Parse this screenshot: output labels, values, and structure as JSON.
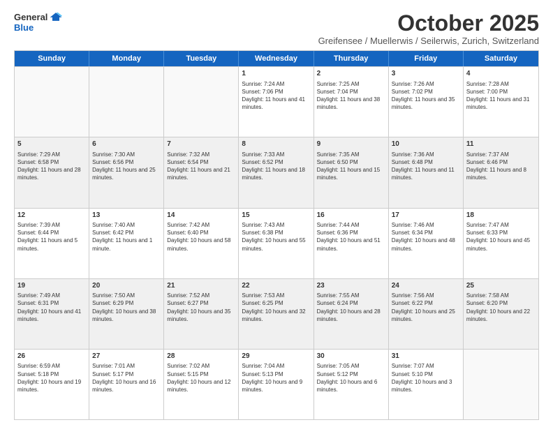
{
  "header": {
    "logo": {
      "general": "General",
      "blue": "Blue"
    },
    "title": "October 2025",
    "subtitle": "Greifensee / Muellerwis / Seilerwis, Zurich, Switzerland"
  },
  "days_of_week": [
    "Sunday",
    "Monday",
    "Tuesday",
    "Wednesday",
    "Thursday",
    "Friday",
    "Saturday"
  ],
  "weeks": [
    [
      {
        "day": "",
        "empty": true
      },
      {
        "day": "",
        "empty": true
      },
      {
        "day": "",
        "empty": true
      },
      {
        "day": "1",
        "sunrise": "7:24 AM",
        "sunset": "7:06 PM",
        "daylight": "11 hours and 41 minutes."
      },
      {
        "day": "2",
        "sunrise": "7:25 AM",
        "sunset": "7:04 PM",
        "daylight": "11 hours and 38 minutes."
      },
      {
        "day": "3",
        "sunrise": "7:26 AM",
        "sunset": "7:02 PM",
        "daylight": "11 hours and 35 minutes."
      },
      {
        "day": "4",
        "sunrise": "7:28 AM",
        "sunset": "7:00 PM",
        "daylight": "11 hours and 31 minutes."
      }
    ],
    [
      {
        "day": "5",
        "sunrise": "7:29 AM",
        "sunset": "6:58 PM",
        "daylight": "11 hours and 28 minutes."
      },
      {
        "day": "6",
        "sunrise": "7:30 AM",
        "sunset": "6:56 PM",
        "daylight": "11 hours and 25 minutes."
      },
      {
        "day": "7",
        "sunrise": "7:32 AM",
        "sunset": "6:54 PM",
        "daylight": "11 hours and 21 minutes."
      },
      {
        "day": "8",
        "sunrise": "7:33 AM",
        "sunset": "6:52 PM",
        "daylight": "11 hours and 18 minutes."
      },
      {
        "day": "9",
        "sunrise": "7:35 AM",
        "sunset": "6:50 PM",
        "daylight": "11 hours and 15 minutes."
      },
      {
        "day": "10",
        "sunrise": "7:36 AM",
        "sunset": "6:48 PM",
        "daylight": "11 hours and 11 minutes."
      },
      {
        "day": "11",
        "sunrise": "7:37 AM",
        "sunset": "6:46 PM",
        "daylight": "11 hours and 8 minutes."
      }
    ],
    [
      {
        "day": "12",
        "sunrise": "7:39 AM",
        "sunset": "6:44 PM",
        "daylight": "11 hours and 5 minutes."
      },
      {
        "day": "13",
        "sunrise": "7:40 AM",
        "sunset": "6:42 PM",
        "daylight": "11 hours and 1 minute."
      },
      {
        "day": "14",
        "sunrise": "7:42 AM",
        "sunset": "6:40 PM",
        "daylight": "10 hours and 58 minutes."
      },
      {
        "day": "15",
        "sunrise": "7:43 AM",
        "sunset": "6:38 PM",
        "daylight": "10 hours and 55 minutes."
      },
      {
        "day": "16",
        "sunrise": "7:44 AM",
        "sunset": "6:36 PM",
        "daylight": "10 hours and 51 minutes."
      },
      {
        "day": "17",
        "sunrise": "7:46 AM",
        "sunset": "6:34 PM",
        "daylight": "10 hours and 48 minutes."
      },
      {
        "day": "18",
        "sunrise": "7:47 AM",
        "sunset": "6:33 PM",
        "daylight": "10 hours and 45 minutes."
      }
    ],
    [
      {
        "day": "19",
        "sunrise": "7:49 AM",
        "sunset": "6:31 PM",
        "daylight": "10 hours and 41 minutes."
      },
      {
        "day": "20",
        "sunrise": "7:50 AM",
        "sunset": "6:29 PM",
        "daylight": "10 hours and 38 minutes."
      },
      {
        "day": "21",
        "sunrise": "7:52 AM",
        "sunset": "6:27 PM",
        "daylight": "10 hours and 35 minutes."
      },
      {
        "day": "22",
        "sunrise": "7:53 AM",
        "sunset": "6:25 PM",
        "daylight": "10 hours and 32 minutes."
      },
      {
        "day": "23",
        "sunrise": "7:55 AM",
        "sunset": "6:24 PM",
        "daylight": "10 hours and 28 minutes."
      },
      {
        "day": "24",
        "sunrise": "7:56 AM",
        "sunset": "6:22 PM",
        "daylight": "10 hours and 25 minutes."
      },
      {
        "day": "25",
        "sunrise": "7:58 AM",
        "sunset": "6:20 PM",
        "daylight": "10 hours and 22 minutes."
      }
    ],
    [
      {
        "day": "26",
        "sunrise": "6:59 AM",
        "sunset": "5:18 PM",
        "daylight": "10 hours and 19 minutes."
      },
      {
        "day": "27",
        "sunrise": "7:01 AM",
        "sunset": "5:17 PM",
        "daylight": "10 hours and 16 minutes."
      },
      {
        "day": "28",
        "sunrise": "7:02 AM",
        "sunset": "5:15 PM",
        "daylight": "10 hours and 12 minutes."
      },
      {
        "day": "29",
        "sunrise": "7:04 AM",
        "sunset": "5:13 PM",
        "daylight": "10 hours and 9 minutes."
      },
      {
        "day": "30",
        "sunrise": "7:05 AM",
        "sunset": "5:12 PM",
        "daylight": "10 hours and 6 minutes."
      },
      {
        "day": "31",
        "sunrise": "7:07 AM",
        "sunset": "5:10 PM",
        "daylight": "10 hours and 3 minutes."
      },
      {
        "day": "",
        "empty": true
      }
    ]
  ],
  "labels": {
    "sunrise_prefix": "Sunrise: ",
    "sunset_prefix": "Sunset: ",
    "daylight_prefix": "Daylight: "
  }
}
